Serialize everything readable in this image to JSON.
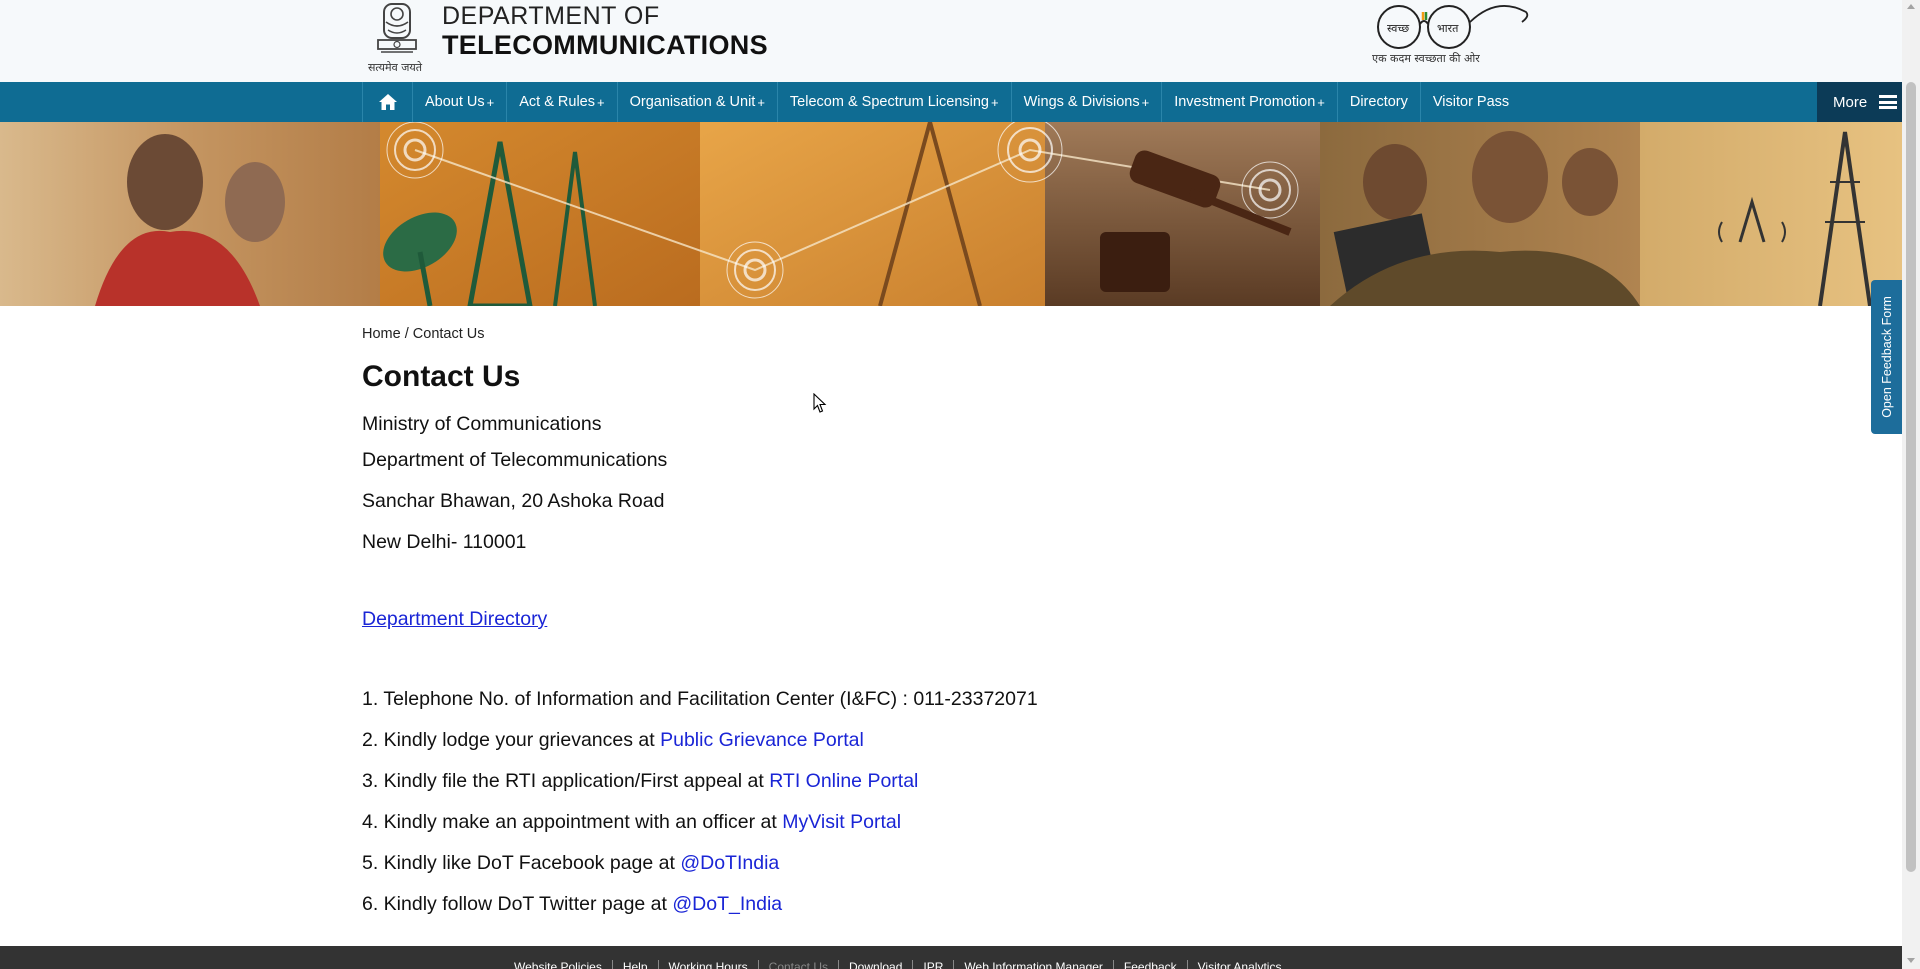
{
  "header": {
    "emblem_caption": "सत्यमेव जयते",
    "dept_line1": "DEPARTMENT OF",
    "dept_line2": "TELECOMMUNICATIONS",
    "swachh_word1": "स्वच्छ",
    "swachh_word2": "भारत",
    "swachh_caption": "एक कदम स्वच्छता की ओर"
  },
  "nav": {
    "items": [
      {
        "label": "About Us",
        "plus": "+"
      },
      {
        "label": "Act & Rules",
        "plus": "+"
      },
      {
        "label": "Organisation & Unit",
        "plus": "+"
      },
      {
        "label": "Telecom & Spectrum Licensing",
        "plus": "+"
      },
      {
        "label": "Wings & Divisions",
        "plus": "+"
      },
      {
        "label": "Investment Promotion",
        "plus": "+"
      },
      {
        "label": "Directory",
        "plus": ""
      },
      {
        "label": "Visitor Pass",
        "plus": ""
      }
    ],
    "more_label": "More"
  },
  "breadcrumb": {
    "home": "Home",
    "separator": "/",
    "current": "Contact Us"
  },
  "content": {
    "title": "Contact Us",
    "address": [
      "Ministry of Communications",
      "Department of Telecommunications",
      "Sanchar Bhawan, 20 Ashoka Road",
      "New Delhi- 110001"
    ],
    "directory_link": "Department Directory",
    "items": [
      {
        "text": "1. Telephone No. of Information and Facilitation Center (I&FC) : 011-23372071",
        "link": ""
      },
      {
        "text": "2. Kindly lodge your grievances at ",
        "link": "Public Grievance Portal"
      },
      {
        "text": "3. Kindly file the RTI application/First appeal at ",
        "link": "RTI Online Portal"
      },
      {
        "text": "4. Kindly make an appointment with an officer at ",
        "link": "MyVisit Portal"
      },
      {
        "text": "5. Kindly like DoT Facebook page at ",
        "link": "@DoTIndia"
      },
      {
        "text": "6. Kindly follow DoT Twitter page at ",
        "link": "@DoT_India"
      }
    ]
  },
  "feedback_tab": "Open Feedback Form",
  "footer": {
    "links": [
      "Website Policies",
      "Help",
      "Working Hours",
      "Contact Us",
      "Download",
      "IPR",
      "Web Information Manager",
      "Feedback",
      "Visitor Analytics"
    ],
    "active": "Contact Us"
  },
  "colors": {
    "nav_bg": "#0f6c93",
    "more_bg": "#0c3b57",
    "link": "#1a25d6",
    "footer_bg": "#333333",
    "feedback_bg": "#1d6d9b"
  }
}
